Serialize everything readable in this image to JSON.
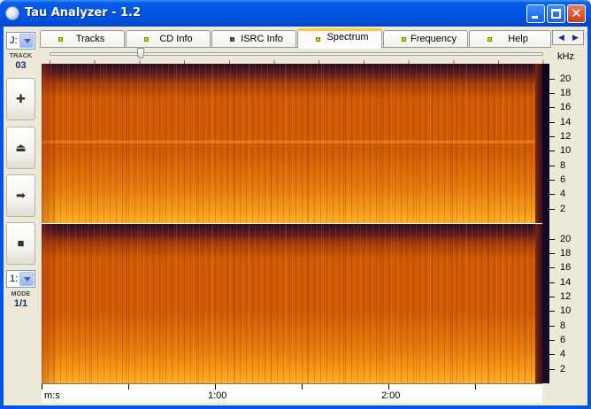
{
  "window": {
    "title": "Tau Analyzer - 1.2",
    "min_label": "",
    "max_label": "",
    "close_label": "✕"
  },
  "left_toolbar": {
    "drive_value": "J:",
    "track_caption": "TRACK",
    "track_number": "03",
    "buttons": [
      {
        "name": "add",
        "icon": "plus-icon",
        "glyph": "✚"
      },
      {
        "name": "eject",
        "icon": "eject-icon",
        "glyph": "⏏"
      },
      {
        "name": "play",
        "icon": "arrow-right-icon",
        "glyph": "➡"
      },
      {
        "name": "stop",
        "icon": "stop-icon",
        "glyph": "■"
      }
    ],
    "mode_select_value": "1:",
    "mode_caption": "MODE",
    "mode_value": "1/1"
  },
  "tabs": [
    {
      "label": "Tracks",
      "led": "green",
      "active": false
    },
    {
      "label": "CD Info",
      "led": "green",
      "active": false
    },
    {
      "label": "ISRC Info",
      "led": "dark",
      "active": false
    },
    {
      "label": "Spectrum",
      "led": "green",
      "active": true
    },
    {
      "label": "Frequency",
      "led": "green",
      "active": false
    },
    {
      "label": "Help",
      "led": "green",
      "active": false
    }
  ],
  "tab_scroll": {
    "left": "◀",
    "right": "▶"
  },
  "spectrum": {
    "unit_label": "kHz",
    "y_ticks": [
      "20",
      "18",
      "16",
      "14",
      "12",
      "10",
      "8",
      "6",
      "4",
      "2"
    ],
    "time_unit_label": "m:s",
    "time_labels": [
      "1:00",
      "2:00"
    ],
    "zoom_slider_position": 0.18,
    "palette": {
      "low": "#2b0c22",
      "mid": "#cf5a06",
      "high": "#ffb02a"
    }
  }
}
